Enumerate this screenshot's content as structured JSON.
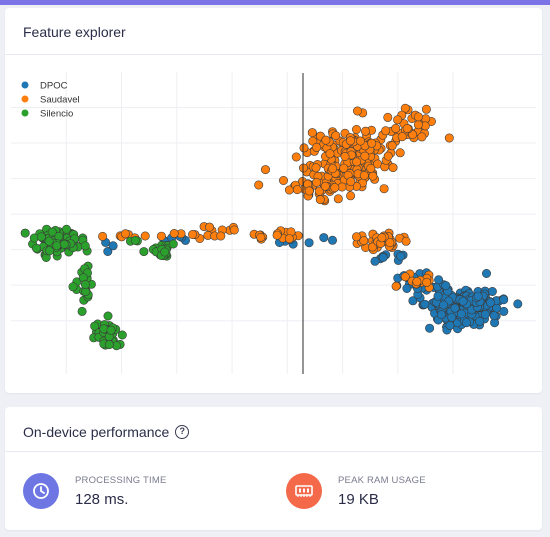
{
  "explorer": {
    "title": "Feature explorer"
  },
  "chart_data": {
    "type": "scatter",
    "title": "",
    "xlabel": "",
    "ylabel": "",
    "xlim": [
      0,
      100
    ],
    "ylim": [
      0,
      100
    ],
    "grid": true,
    "legend_position": "top-left",
    "series": [
      {
        "name": "DPOC",
        "color": "#1f77b4",
        "clusters": [
          {
            "center": [
              86,
              22
            ],
            "spread": [
              5.5,
              5
            ],
            "count": 230,
            "seed": 11
          },
          {
            "center": [
              78,
              30
            ],
            "spread": [
              3,
              3
            ],
            "count": 30,
            "seed": 12
          },
          {
            "center": [
              72,
              39
            ],
            "spread": [
              2,
              2
            ],
            "count": 10,
            "seed": 13
          },
          {
            "center": [
              57,
              44
            ],
            "spread": [
              6,
              1.5
            ],
            "count": 8,
            "seed": 14
          },
          {
            "center": [
              32,
              45
            ],
            "spread": [
              2,
              1.5
            ],
            "count": 5,
            "seed": 15
          },
          {
            "center": [
              19,
              42
            ],
            "spread": [
              1.5,
              1.5
            ],
            "count": 3,
            "seed": 16
          }
        ]
      },
      {
        "name": "Saudavel",
        "color": "#ff7f0e",
        "clusters": [
          {
            "center": [
              65,
              72
            ],
            "spread": [
              7,
              8
            ],
            "count": 200,
            "seed": 21
          },
          {
            "center": [
              76,
              82
            ],
            "spread": [
              4,
              4
            ],
            "count": 30,
            "seed": 22
          },
          {
            "center": [
              58,
              62
            ],
            "spread": [
              6,
              3.5
            ],
            "count": 40,
            "seed": 23
          },
          {
            "center": [
              70,
              44
            ],
            "spread": [
              5,
              3
            ],
            "count": 35,
            "seed": 24
          },
          {
            "center": [
              78,
              31
            ],
            "spread": [
              3,
              2
            ],
            "count": 15,
            "seed": 25
          },
          {
            "center": [
              39,
              47
            ],
            "spread": [
              7,
              2
            ],
            "count": 18,
            "seed": 26
          },
          {
            "center": [
              52,
              46
            ],
            "spread": [
              4,
              1.5
            ],
            "count": 12,
            "seed": 27
          },
          {
            "center": [
              22,
              46
            ],
            "spread": [
              6,
              1.5
            ],
            "count": 8,
            "seed": 28
          }
        ]
      },
      {
        "name": "Silencio",
        "color": "#2ca02c",
        "clusters": [
          {
            "center": [
              9,
              44
            ],
            "spread": [
              3.5,
              3
            ],
            "count": 120,
            "seed": 31
          },
          {
            "center": [
              14,
              30
            ],
            "spread": [
              2.5,
              5
            ],
            "count": 20,
            "seed": 32
          },
          {
            "center": [
              18,
              13
            ],
            "spread": [
              1.8,
              3.5
            ],
            "count": 45,
            "seed": 33
          },
          {
            "center": [
              29,
              41
            ],
            "spread": [
              2,
              2
            ],
            "count": 25,
            "seed": 34
          },
          {
            "center": [
              23,
              44
            ],
            "spread": [
              1.2,
              1
            ],
            "count": 3,
            "seed": 35
          }
        ]
      }
    ]
  },
  "performance": {
    "title": "On-device performance",
    "help_icon": "question-circle-icon",
    "metrics": [
      {
        "label": "PROCESSING TIME",
        "value": "128 ms.",
        "icon": "clock-icon",
        "color": "#6e76e3"
      },
      {
        "label": "PEAK RAM USAGE",
        "value": "19 KB",
        "icon": "memory-chip-icon",
        "color": "#f4694a"
      }
    ]
  }
}
